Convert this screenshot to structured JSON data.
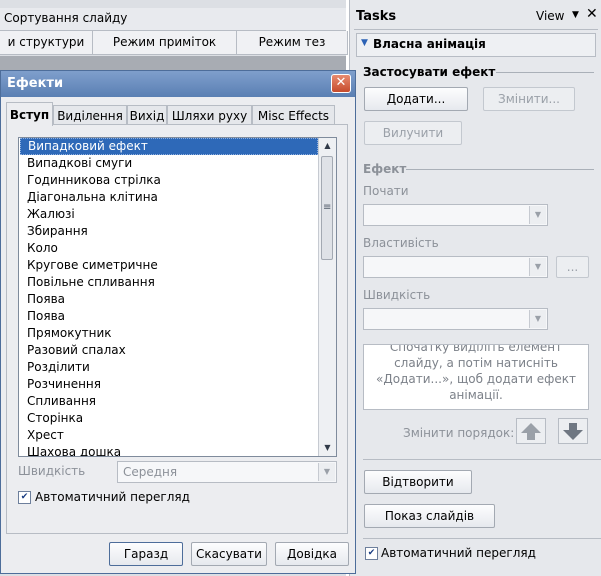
{
  "background": {
    "slide_sorter_tab": "Сортування слайду",
    "view_tabs": [
      "и структури",
      "Режим приміток",
      "Режим тез"
    ]
  },
  "task_pane": {
    "title": "Tasks",
    "view_label": "View",
    "section_title": "Власна анімація",
    "apply_group": "Застосувати ефект",
    "add_button": "Додати...",
    "change_button": "Змінити...",
    "remove_button": "Вилучити",
    "effect_group": "Ефект",
    "start_label": "Почати",
    "property_label": "Властивість",
    "property_more": "...",
    "speed_label": "Швидкість",
    "hint": "Спочатку виділіть елемент слайду, а потім натисніть «Додати...», щоб додати ефект анімації.",
    "order_label": "Змінити порядок:",
    "play_button": "Відтворити",
    "slideshow_button": "Показ слайдів",
    "autopreview_label": "Автоматичний перегляд",
    "autopreview_checked": true
  },
  "dialog": {
    "title": "Ефекти",
    "tabs": [
      "Вступ",
      "Виділення",
      "Вихід",
      "Шляхи руху",
      "Misc Effects"
    ],
    "active_tab": 0,
    "effects": [
      "Випадковий ефект",
      "Випадкові смуги",
      "Годинникова стрілка",
      "Діагональна клітина",
      "Жалюзі",
      "Збирання",
      "Коло",
      "Кругове симетричне",
      "Повільне спливання",
      "Поява",
      "Поява",
      "Прямокутник",
      "Разовий спалах",
      "Розділити",
      "Розчинення",
      "Спливання",
      "Сторінка",
      "Хрест",
      "Шахова дошка"
    ],
    "selected_index": 0,
    "speed_label": "Швидкість",
    "speed_value": "Середня",
    "autopreview_label": "Автоматичний перегляд",
    "autopreview_checked": true,
    "ok_button": "Гаразд",
    "cancel_button": "Скасувати",
    "help_button": "Довідка"
  },
  "icons": {
    "close": "close-icon",
    "dropdown": "chevron-down-icon",
    "move_up": "arrow-up-icon",
    "move_down": "arrow-down-icon",
    "section_toggle": "triangle-down-icon"
  },
  "colors": {
    "selection": "#2e69b8",
    "dialog_title": "#5a7fb3",
    "close_button": "#c64b2c"
  }
}
